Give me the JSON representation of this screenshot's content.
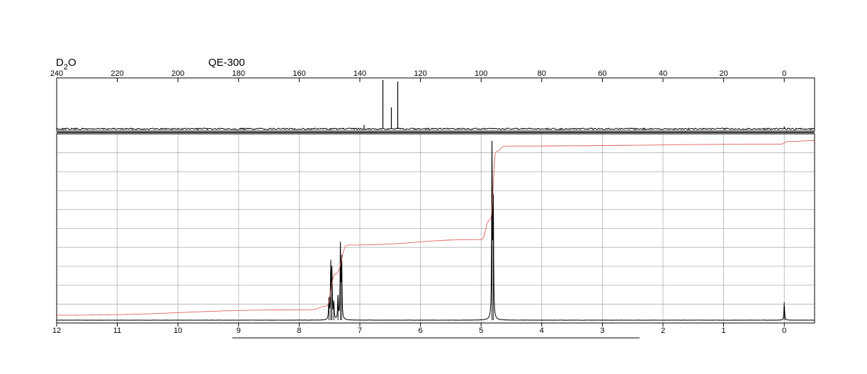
{
  "header": {
    "solvent_main": "D",
    "solvent_sub": "2",
    "solvent_tail": "O",
    "instrument": "QE-300"
  },
  "colors": {
    "spectrum": "#000000",
    "integral": "#e06060",
    "grid": "#b0b0b0",
    "frame": "#000000"
  },
  "chart_data": [
    {
      "name": "13C spectrum",
      "type": "line",
      "xlabel": "",
      "ylabel": "",
      "xlim": [
        240,
        -10
      ],
      "x_direction": "reversed",
      "tick_labels": [
        "240",
        "220",
        "200",
        "180",
        "160",
        "140",
        "120",
        "100",
        "80",
        "60",
        "40",
        "20",
        "0"
      ],
      "ticks": [
        240,
        220,
        200,
        180,
        160,
        140,
        120,
        100,
        80,
        60,
        40,
        20,
        0
      ],
      "grid": false,
      "peaks": [
        {
          "ppm": 138.6,
          "height": 0.08
        },
        {
          "ppm": 132.4,
          "height": 1.0
        },
        {
          "ppm": 129.6,
          "height": 0.44
        },
        {
          "ppm": 127.5,
          "height": 0.97
        },
        {
          "ppm": 0.0,
          "height": 0.05
        }
      ]
    },
    {
      "name": "1H spectrum",
      "type": "line",
      "xlabel": "",
      "ylabel": "",
      "xlim": [
        12,
        -0.5
      ],
      "x_direction": "reversed",
      "tick_labels": [
        "12",
        "11",
        "10",
        "9",
        "8",
        "7",
        "6",
        "5",
        "4",
        "3",
        "2",
        "1",
        "0"
      ],
      "ticks": [
        12,
        11,
        10,
        9,
        8,
        7,
        6,
        5,
        4,
        3,
        2,
        1,
        0
      ],
      "grid": true,
      "horizontal_gridlines": 10,
      "peaks": [
        {
          "ppm": 7.51,
          "height": 0.12
        },
        {
          "ppm": 7.48,
          "height": 0.31
        },
        {
          "ppm": 7.46,
          "height": 0.28
        },
        {
          "ppm": 7.43,
          "height": 0.1
        },
        {
          "ppm": 7.36,
          "height": 0.14
        },
        {
          "ppm": 7.32,
          "height": 0.42
        },
        {
          "ppm": 7.3,
          "height": 0.36
        },
        {
          "ppm": 4.82,
          "height": 0.98
        },
        {
          "ppm": 4.8,
          "height": 0.7
        },
        {
          "ppm": 0.0,
          "height": 0.1
        }
      ],
      "integral": [
        {
          "ppm": 12.0,
          "level": 0.02
        },
        {
          "ppm": 7.8,
          "level": 0.05
        },
        {
          "ppm": 7.55,
          "level": 0.07
        },
        {
          "ppm": 7.4,
          "level": 0.25
        },
        {
          "ppm": 7.2,
          "level": 0.41
        },
        {
          "ppm": 5.0,
          "level": 0.44
        },
        {
          "ppm": 4.85,
          "level": 0.55
        },
        {
          "ppm": 4.75,
          "level": 0.93
        },
        {
          "ppm": 4.6,
          "level": 0.96
        },
        {
          "ppm": 0.05,
          "level": 0.97
        },
        {
          "ppm": -0.05,
          "level": 0.985
        },
        {
          "ppm": -0.5,
          "level": 0.99
        }
      ]
    }
  ]
}
